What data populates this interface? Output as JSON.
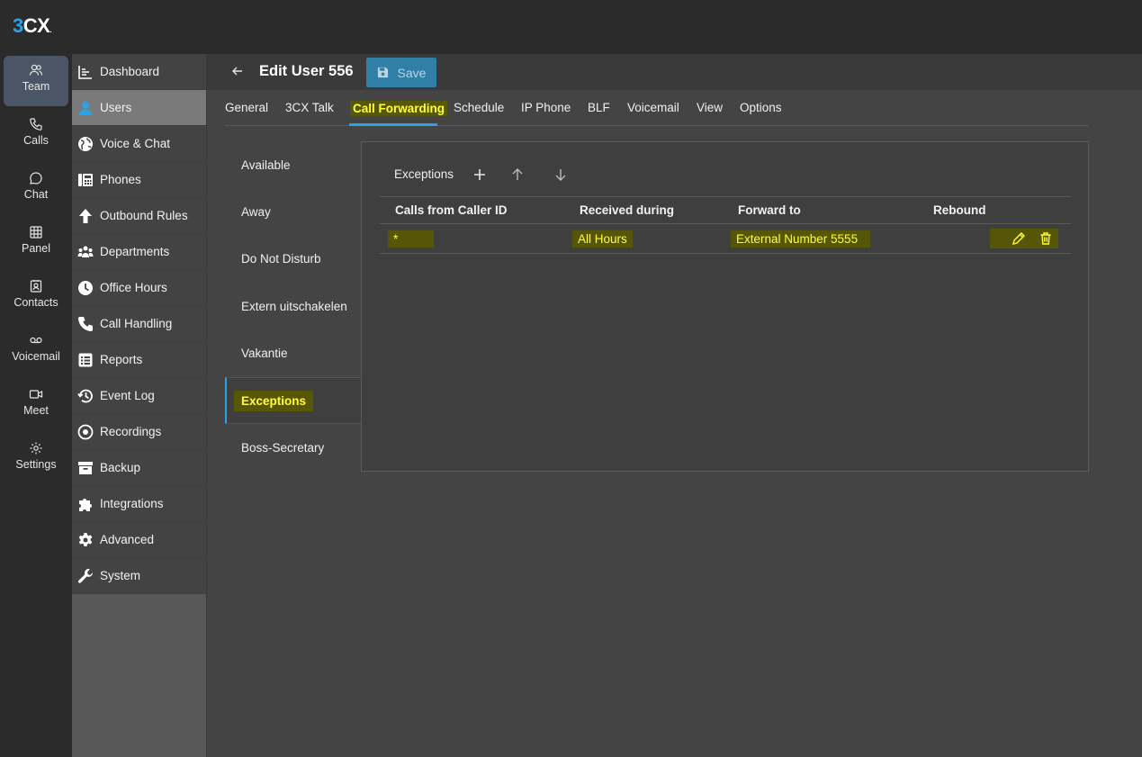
{
  "app": {
    "logo_main": "3CX",
    "logo_dot": "."
  },
  "rail": [
    {
      "label": "Team",
      "icon": "team-icon",
      "active": true
    },
    {
      "label": "Calls",
      "icon": "phone-icon"
    },
    {
      "label": "Chat",
      "icon": "chat-icon"
    },
    {
      "label": "Panel",
      "icon": "panel-grid-icon"
    },
    {
      "label": "Contacts",
      "icon": "contacts-icon"
    },
    {
      "label": "Voicemail",
      "icon": "voicemail-icon"
    },
    {
      "label": "Meet",
      "icon": "video-icon"
    },
    {
      "label": "Settings",
      "icon": "gear-icon"
    }
  ],
  "nav": [
    {
      "label": "Dashboard",
      "icon": "dashboard-icon"
    },
    {
      "label": "Users",
      "icon": "user-icon",
      "active": true
    },
    {
      "label": "Voice & Chat",
      "icon": "globe-icon"
    },
    {
      "label": "Phones",
      "icon": "desk-phone-icon"
    },
    {
      "label": "Outbound Rules",
      "icon": "arrow-up-icon"
    },
    {
      "label": "Departments",
      "icon": "departments-icon"
    },
    {
      "label": "Office Hours",
      "icon": "clock-icon"
    },
    {
      "label": "Call Handling",
      "icon": "handset-icon"
    },
    {
      "label": "Reports",
      "icon": "list-icon"
    },
    {
      "label": "Event Log",
      "icon": "history-icon"
    },
    {
      "label": "Recordings",
      "icon": "record-icon"
    },
    {
      "label": "Backup",
      "icon": "archive-icon"
    },
    {
      "label": "Integrations",
      "icon": "puzzle-icon"
    },
    {
      "label": "Advanced",
      "icon": "cog-icon"
    },
    {
      "label": "System",
      "icon": "wrench-icon"
    }
  ],
  "header": {
    "title": "Edit User 556",
    "save_label": "Save"
  },
  "tabs": [
    "General",
    "3CX Talk",
    "Call Forwarding",
    "Schedule",
    "IP Phone",
    "BLF",
    "Voicemail",
    "View",
    "Options"
  ],
  "active_tab": "Call Forwarding",
  "subnav": [
    "Available",
    "Away",
    "Do Not Disturb",
    "Extern uitschakelen",
    "Vakantie",
    "Exceptions",
    "Boss-Secretary"
  ],
  "active_subnav": "Exceptions",
  "panel": {
    "toolbar_label": "Exceptions",
    "columns": [
      "Calls from Caller ID",
      "Received during",
      "Forward to",
      "Rebound"
    ],
    "rows": [
      {
        "caller_id": "*",
        "received_during": "All Hours",
        "forward_to": "External Number 5555",
        "rebound": ""
      }
    ]
  },
  "colors": {
    "accent": "#2aa2e8",
    "highlight_text": "#ffff33",
    "save_button": "#2f7fa6"
  }
}
